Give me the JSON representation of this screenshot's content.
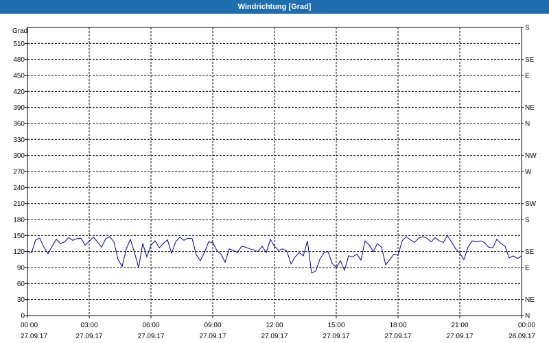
{
  "window": {
    "title": "Windrichtung [Grad]"
  },
  "colors": {
    "titlebar": "#1e6dae",
    "series": "#00008b",
    "grid": "#000000"
  },
  "chart_data": {
    "type": "line",
    "title": "Windrichtung [Grad]",
    "ylabel": "Grad",
    "ylim": [
      0,
      540
    ],
    "y_ticks": [
      0,
      30,
      60,
      90,
      120,
      150,
      180,
      210,
      240,
      270,
      300,
      330,
      360,
      390,
      420,
      450,
      480,
      510
    ],
    "right_axis_labels": [
      "N",
      "NE",
      "E",
      "SE",
      "S",
      "SW",
      "W",
      "NW",
      "N",
      "NE",
      "E",
      "SE",
      "S"
    ],
    "right_axis_values": [
      0,
      30,
      90,
      120,
      180,
      210,
      270,
      300,
      360,
      390,
      450,
      480,
      540
    ],
    "x_tick_hours": [
      0,
      3,
      6,
      9,
      12,
      15,
      18,
      21,
      24
    ],
    "x_tick_labels": [
      {
        "time": "00:00",
        "date": "27.09.17"
      },
      {
        "time": "03:00",
        "date": "27.09.17"
      },
      {
        "time": "06:00",
        "date": "27.09.17"
      },
      {
        "time": "09:00",
        "date": "27.09.17"
      },
      {
        "time": "12:00",
        "date": "27.09.17"
      },
      {
        "time": "15:00",
        "date": "27.09.17"
      },
      {
        "time": "18:00",
        "date": "27.09.17"
      },
      {
        "time": "21:00",
        "date": "27.09.17"
      },
      {
        "time": "00:00",
        "date": "28.09.17"
      }
    ],
    "grid": true,
    "series": [
      {
        "x_hours": [
          0.0,
          0.2,
          0.4,
          0.6,
          0.8,
          1.0,
          1.2,
          1.4,
          1.6,
          1.8,
          2.0,
          2.2,
          2.4,
          2.6,
          2.8,
          3.0,
          3.2,
          3.4,
          3.6,
          3.8,
          4.0,
          4.2,
          4.4,
          4.6,
          4.8,
          5.0,
          5.2,
          5.4,
          5.6,
          5.8,
          6.0,
          6.2,
          6.4,
          6.6,
          6.8,
          7.0,
          7.2,
          7.4,
          7.6,
          7.8,
          8.0,
          8.2,
          8.4,
          8.6,
          8.8,
          9.0,
          9.2,
          9.4,
          9.6,
          9.8,
          10.0,
          10.2,
          10.4,
          10.6,
          10.8,
          11.0,
          11.2,
          11.4,
          11.6,
          11.8,
          12.0,
          12.2,
          12.4,
          12.6,
          12.8,
          13.0,
          13.2,
          13.4,
          13.6,
          13.8,
          14.0,
          14.2,
          14.4,
          14.6,
          14.8,
          15.0,
          15.2,
          15.4,
          15.6,
          15.8,
          16.0,
          16.2,
          16.4,
          16.6,
          16.8,
          17.0,
          17.2,
          17.4,
          17.6,
          17.8,
          18.0,
          18.2,
          18.4,
          18.6,
          18.8,
          19.0,
          19.2,
          19.4,
          19.6,
          19.8,
          20.0,
          20.2,
          20.4,
          20.6,
          20.8,
          21.0,
          21.2,
          21.4,
          21.6,
          21.8,
          22.0,
          22.2,
          22.4,
          22.6,
          22.8,
          23.0,
          23.2,
          23.4,
          23.6,
          23.8,
          24.0
        ],
        "values": [
          120,
          118,
          142,
          145,
          128,
          116,
          130,
          143,
          135,
          138,
          146,
          141,
          144,
          145,
          132,
          139,
          147,
          138,
          128,
          144,
          148,
          138,
          105,
          92,
          125,
          143,
          118,
          90,
          135,
          110,
          132,
          140,
          127,
          135,
          142,
          117,
          138,
          147,
          141,
          145,
          144,
          114,
          103,
          118,
          138,
          137,
          122,
          115,
          100,
          125,
          122,
          118,
          130,
          128,
          125,
          123,
          120,
          130,
          118,
          143,
          130,
          122,
          125,
          121,
          97,
          110,
          118,
          112,
          140,
          80,
          83,
          105,
          118,
          120,
          98,
          90,
          103,
          85,
          112,
          110,
          115,
          104,
          140,
          132,
          120,
          135,
          128,
          95,
          105,
          115,
          113,
          140,
          148,
          142,
          137,
          145,
          148,
          145,
          138,
          146,
          140,
          137,
          150,
          138,
          125,
          117,
          105,
          128,
          140,
          138,
          140,
          137,
          128,
          127,
          143,
          135,
          130,
          108,
          112,
          107,
          112,
          110,
          108,
          105,
          106,
          110,
          115,
          120,
          112,
          115,
          113,
          118,
          112,
          118,
          105,
          108,
          115
        ]
      }
    ]
  }
}
